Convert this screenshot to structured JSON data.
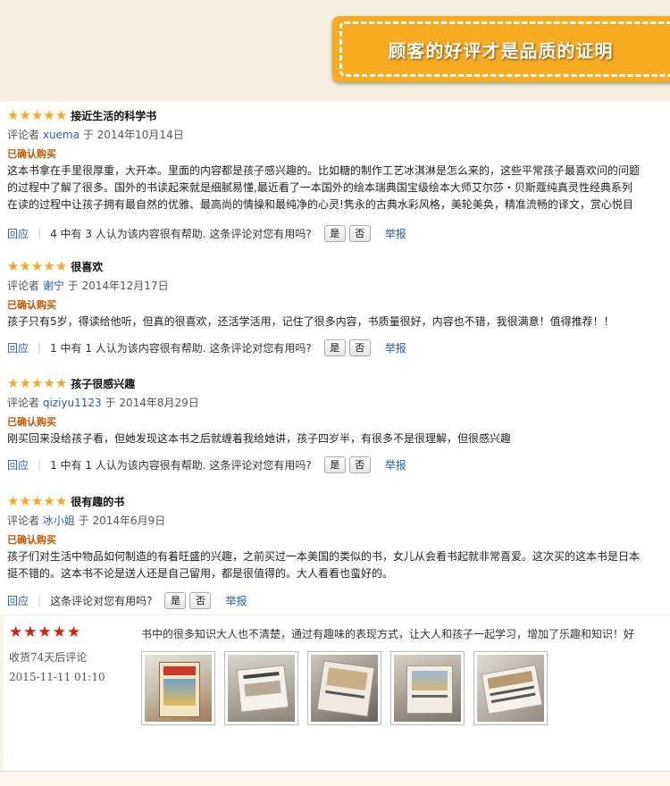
{
  "banner": {
    "title": "顾客的好评才是品质的证明"
  },
  "reviews": [
    {
      "stars": 5,
      "title": "接近生活的科学书",
      "meta_prefix": "评论者",
      "author": "xuema",
      "meta_suffix": "于 2014年10月14日",
      "verified": "已确认购买",
      "body": [
        "这本书拿在手里很厚重，大开本。里面的内容都是孩子感兴趣的。比如糖的制作工艺冰淇淋是怎么来的，这些平常孩子最喜欢问的问题",
        "的过程中了解了很多。国外的书读起来就是细腻易懂,最近看了一本国外的绘本瑞典国宝级绘本大师艾尔莎・贝斯蔻纯真灵性经典系列",
        "在读的过程中让孩子拥有最自然的优雅、最高尚的情操和最纯净的心灵!隽永的古典水彩风格，美轮美奂，精准流畅的译文，赏心悦目"
      ],
      "reply": "回应",
      "helpful_text": "4 中有 3 人认为该内容很有帮助. 这条评论对您有用吗?",
      "yes": "是",
      "no": "否",
      "report": "举报"
    },
    {
      "stars": 5,
      "title": "很喜欢",
      "meta_prefix": "评论者",
      "author": "谢宁",
      "meta_suffix": "于 2014年12月17日",
      "verified": "已确认购买",
      "body": [
        "孩子只有5岁，得读给他听，但真的很喜欢，还活学活用，记住了很多内容，书质量很好，内容也不错，我很满意！值得推荐！！"
      ],
      "reply": "回应",
      "helpful_text": "1 中有 1 人认为该内容很有帮助. 这条评论对您有用吗?",
      "yes": "是",
      "no": "否",
      "report": "举报"
    },
    {
      "stars": 5,
      "title": "孩子很感兴趣",
      "meta_prefix": "评论者",
      "author": "qiziyu1123",
      "meta_suffix": "于 2014年8月29日",
      "verified": "已确认购买",
      "body": [
        "刚买回来没给孩子看，但她发现这本书之后就缠着我给她讲，孩子四岁半，有很多不是很理解，但很感兴趣"
      ],
      "reply": "回应",
      "helpful_text": "1 中有 1 人认为该内容很有帮助. 这条评论对您有用吗?",
      "yes": "是",
      "no": "否",
      "report": "举报"
    },
    {
      "stars": 5,
      "title": "很有趣的书",
      "meta_prefix": "评论者",
      "author": "冰小姐",
      "meta_suffix": "于 2014年6月9日",
      "verified": "已确认购买",
      "body": [
        "孩子们对生活中物品如何制造的有着旺盛的兴趣，之前买过一本美国的类似的书，女儿从会看书起就非常喜爱。这次买的这本书是日本",
        "挺不错的。这本书不论是送人还是自己留用，都是很值得的。大人看看也蛮好的。"
      ],
      "reply": "回应",
      "helpful_text": "这条评论对您有用吗?",
      "yes": "是",
      "no": "否",
      "report": "举报"
    }
  ],
  "store_review": {
    "stars": 5,
    "days_label": "收货74天后评论",
    "datetime": "2015-11-11 01:10",
    "text": "书中的很多知识大人也不清楚，通过有趣味的表现方式，让大人和孩子一起学习，增加了乐趣和知识！好",
    "photos": [
      "photo-1",
      "photo-2",
      "photo-3",
      "photo-4",
      "photo-5"
    ]
  },
  "colors": {
    "banner_orange": "#f6ab20",
    "star_gold": "#f5a623",
    "star_red": "#d81e06",
    "verified_orange": "#c45500",
    "link_blue": "#2a5db0"
  }
}
